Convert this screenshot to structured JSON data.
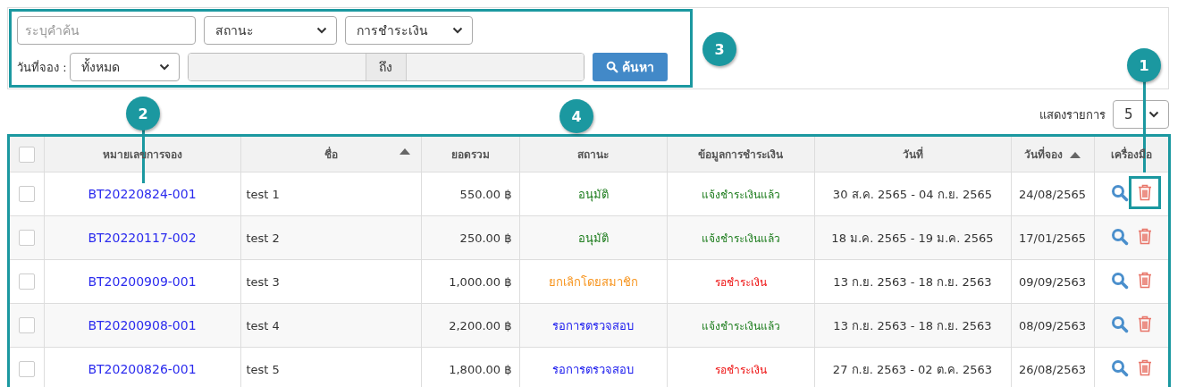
{
  "filters": {
    "search": {
      "placeholder": "ระบุคำค้น"
    },
    "status_select": {
      "value": "สถานะ"
    },
    "payment_select": {
      "value": "การชำระเงิน"
    },
    "date_label": "วันที่จอง :",
    "date_select": {
      "value": "ทั้งหมด"
    },
    "range_separator": "ถึง",
    "search_button": "ค้นหา"
  },
  "page_length": {
    "label": "แสดงรายการ",
    "value": "5"
  },
  "table": {
    "select_all": {
      "checked": false
    },
    "columns": [
      {
        "label": "หมายเลขการจอง",
        "sorted": false
      },
      {
        "label": "ชื่อ",
        "sorted": true
      },
      {
        "label": "ยอดรวม",
        "sorted": false
      },
      {
        "label": "สถานะ",
        "sorted": false
      },
      {
        "label": "ข้อมูลการชำระเงิน",
        "sorted": false
      },
      {
        "label": "วันที่",
        "sorted": false
      },
      {
        "label": "วันที่จอง",
        "sorted": true
      },
      {
        "label": "เครื่องมือ",
        "sorted": false
      }
    ],
    "rows": [
      {
        "checked": false,
        "booking_no": "BT20220824-001",
        "name": "test 1",
        "total": "550.00 ฿",
        "status": {
          "text": "อนุมัติ",
          "color": "#1e7d1e"
        },
        "payment": {
          "text": "แจ้งชำระเงินแล้ว",
          "color": "#1e7d1e"
        },
        "dates": "30 ส.ค. 2565 - 04 ก.ย. 2565",
        "booked": "24/08/2565",
        "highlighted": true
      },
      {
        "checked": false,
        "booking_no": "BT20220117-002",
        "name": "test 2",
        "total": "250.00 ฿",
        "status": {
          "text": "อนุมัติ",
          "color": "#1e7d1e"
        },
        "payment": {
          "text": "แจ้งชำระเงินแล้ว",
          "color": "#1e7d1e"
        },
        "dates": "18 ม.ค. 2565 - 19 ม.ค. 2565",
        "booked": "17/01/2565",
        "highlighted": false
      },
      {
        "checked": false,
        "booking_no": "BT20200909-001",
        "name": "test 3",
        "total": "1,000.00 ฿",
        "status": {
          "text": "ยกเลิกโดยสมาชิก",
          "color": "#f7941d"
        },
        "payment": {
          "text": "รอชำระเงิน",
          "color": "#ee1111"
        },
        "dates": "13 ก.ย. 2563 - 18 ก.ย. 2563",
        "booked": "09/09/2563",
        "highlighted": false
      },
      {
        "checked": false,
        "booking_no": "BT20200908-001",
        "name": "test 4",
        "total": "2,200.00 ฿",
        "status": {
          "text": "รอการตรวจสอบ",
          "color": "#1a1aee"
        },
        "payment": {
          "text": "แจ้งชำระเงินแล้ว",
          "color": "#1e7d1e"
        },
        "dates": "13 ก.ย. 2563 - 18 ก.ย. 2563",
        "booked": "08/09/2563",
        "highlighted": false
      },
      {
        "checked": false,
        "booking_no": "BT20200826-001",
        "name": "test 5",
        "total": "1,800.00 ฿",
        "status": {
          "text": "รอการตรวจสอบ",
          "color": "#1a1aee"
        },
        "payment": {
          "text": "รอชำระเงิน",
          "color": "#ee1111"
        },
        "dates": "27 ก.ย. 2563 - 02 ต.ค. 2563",
        "booked": "26/08/2563",
        "highlighted": false
      }
    ]
  },
  "callouts": [
    {
      "number": "1"
    },
    {
      "number": "2"
    },
    {
      "number": "3"
    },
    {
      "number": "4"
    }
  ]
}
